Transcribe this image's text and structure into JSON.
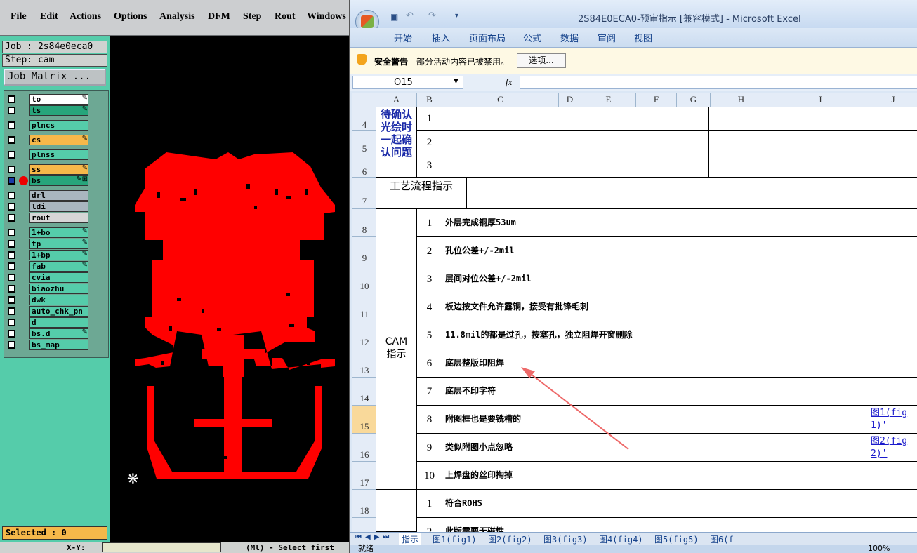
{
  "cam": {
    "menu": [
      "File",
      "Edit",
      "Actions",
      "Options",
      "Analysis",
      "DFM",
      "Step",
      "Rout",
      "Windows"
    ],
    "job_label": "Job : 2s84e0eca0",
    "step_label": "Step: cam",
    "job_matrix": "Job Matrix ...",
    "layers": [
      {
        "name": "to",
        "color": "#ffffff",
        "mark": "✎"
      },
      {
        "name": "ts",
        "color": "#27a57b",
        "mark": "✎"
      },
      {
        "name": "plncs",
        "color": "#55ccaa",
        "mark": ""
      },
      {
        "name": "cs",
        "color": "#f6b84a",
        "mark": "✎"
      },
      {
        "name": "plnss",
        "color": "#55ccaa",
        "mark": ""
      },
      {
        "name": "ss",
        "color": "#f6b84a",
        "mark": "✎"
      },
      {
        "name": "bs",
        "color": "#27a57b",
        "mark": "✎⊞"
      },
      {
        "name": "drl",
        "color": "#a9b6bf",
        "mark": ""
      },
      {
        "name": "ldi",
        "color": "#a9b6bf",
        "mark": ""
      },
      {
        "name": "rout",
        "color": "#d6d6d6",
        "mark": ""
      },
      {
        "name": "1+bo",
        "color": "#55ccaa",
        "mark": "✎"
      },
      {
        "name": "tp",
        "color": "#55ccaa",
        "mark": "✎"
      },
      {
        "name": "1+bp",
        "color": "#55ccaa",
        "mark": "✎"
      },
      {
        "name": "fab",
        "color": "#55ccaa",
        "mark": "✎"
      },
      {
        "name": "cvia",
        "color": "#55ccaa",
        "mark": ""
      },
      {
        "name": "biaozhu",
        "color": "#55ccaa",
        "mark": ""
      },
      {
        "name": "dwk",
        "color": "#55ccaa",
        "mark": ""
      },
      {
        "name": "auto_chk_pn",
        "color": "#55ccaa",
        "mark": ""
      },
      {
        "name": "d",
        "color": "#55ccaa",
        "mark": ""
      },
      {
        "name": "bs.d",
        "color": "#55ccaa",
        "mark": "✎"
      },
      {
        "name": "bs_map",
        "color": "#55ccaa",
        "mark": ""
      }
    ],
    "selected": "Selected : 0",
    "bottom": [
      "X-Y:",
      "(Ml) - Select first"
    ]
  },
  "excel": {
    "title": "2S84E0ECA0-预审指示 [兼容模式] - Microsoft Excel",
    "tabs": [
      "开始",
      "插入",
      "页面布局",
      "公式",
      "数据",
      "审阅",
      "视图"
    ],
    "security_label": "安全警告",
    "security_msg": "部分活动内容已被禁用。",
    "options_btn": "选项...",
    "name_box": "O15",
    "fx": "fx",
    "columns": [
      "A",
      "B",
      "C",
      "D",
      "E",
      "F",
      "G",
      "H",
      "I",
      "J"
    ],
    "rows": [
      "4",
      "5",
      "6",
      "7",
      "8",
      "9",
      "10",
      "11",
      "12",
      "13",
      "14",
      "15",
      "16",
      "17",
      "18",
      ""
    ],
    "pending_label": "待确认光绘时一起确认问题",
    "pending_nums": [
      "1",
      "2",
      "3"
    ],
    "process_label": "工艺流程指示",
    "cam_label": "CAM指示",
    "items": [
      {
        "n": "1",
        "t": "外层完成铜厚53um",
        "link": ""
      },
      {
        "n": "2",
        "t": "孔位公差+/-2mil",
        "link": ""
      },
      {
        "n": "3",
        "t": "层间对位公差+/-2mil",
        "link": ""
      },
      {
        "n": "4",
        "t": "板边按文件允许露铜，接受有批锋毛刺",
        "link": ""
      },
      {
        "n": "5",
        "t": "11.8mil的都是过孔，按塞孔，独立阻焊开窗删除",
        "link": ""
      },
      {
        "n": "6",
        "t": "底层整版印阻焊",
        "link": ""
      },
      {
        "n": "7",
        "t": "底层不印字符",
        "link": ""
      },
      {
        "n": "8",
        "t": "附图框也是要铣槽的",
        "link": "图1(fig1)'"
      },
      {
        "n": "9",
        "t": "类似附图小点忽略",
        "link": "图2(fig2)'"
      },
      {
        "n": "10",
        "t": "上焊盘的丝印掏掉",
        "link": ""
      }
    ],
    "items2": [
      {
        "n": "1",
        "t": "符合ROHS"
      },
      {
        "n": "2",
        "t": "此版需要无磁性"
      }
    ],
    "sheet_tabs": [
      "指示",
      "图1(fig1)",
      "图2(fig2)",
      "图3(fig3)",
      "图4(fig4)",
      "图5(fig5)",
      "图6(f"
    ],
    "status_left": "就绪",
    "zoom": "100%"
  }
}
